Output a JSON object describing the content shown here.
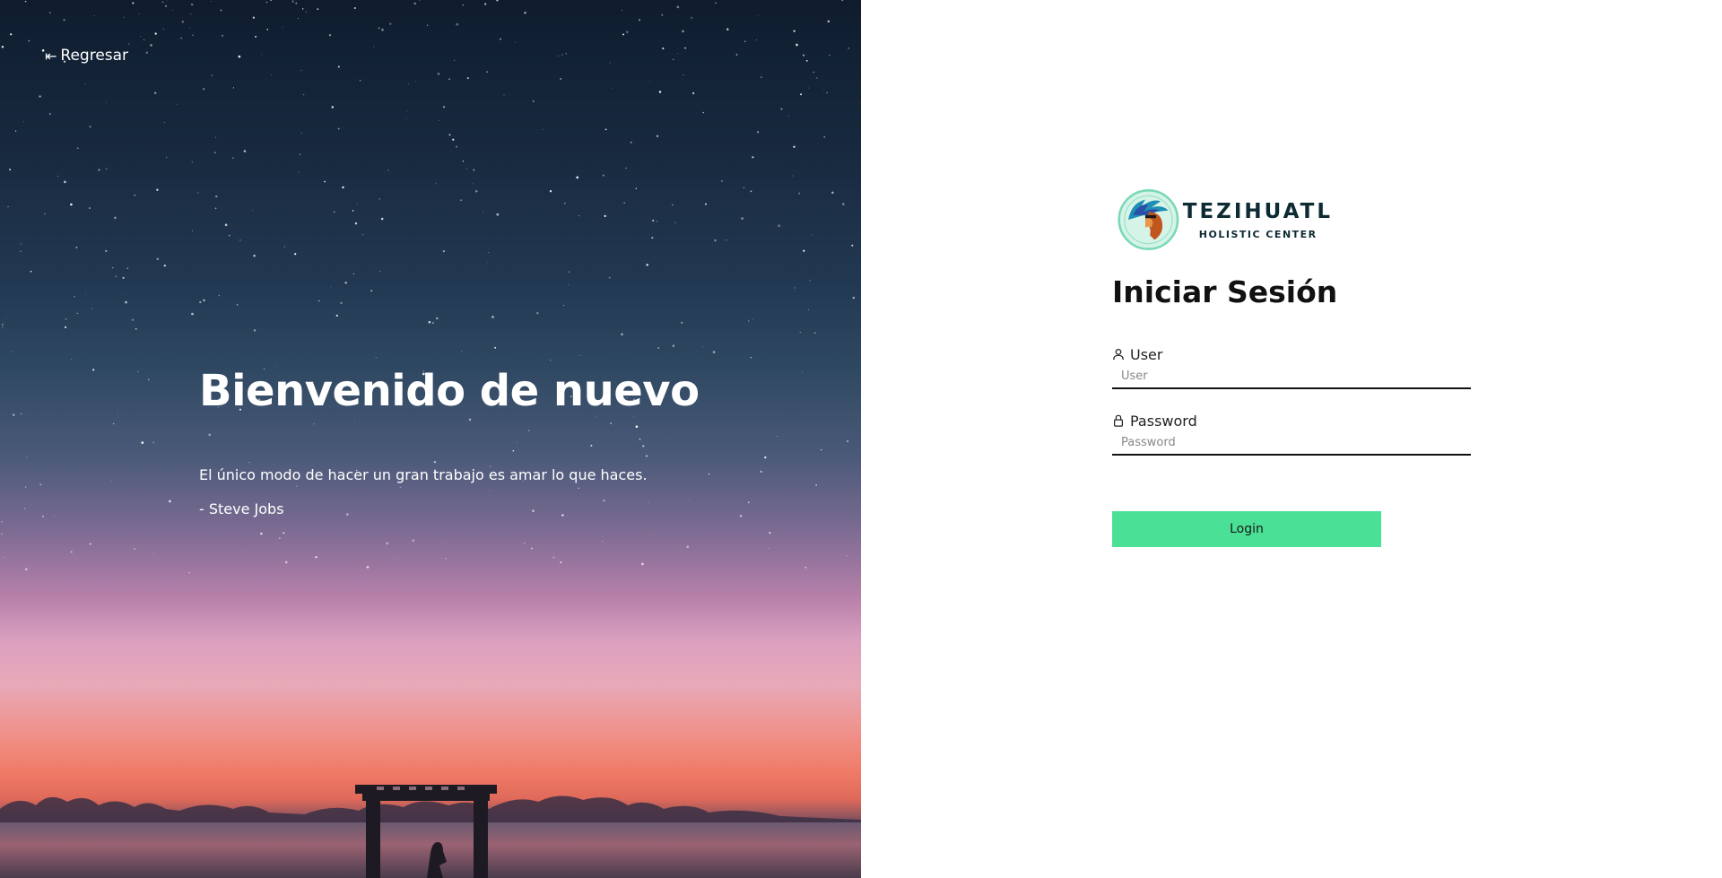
{
  "hero": {
    "back_label": "Regresar",
    "title": "Bienvenido de nuevo",
    "quote": "El único modo de hacer un gran trabajo es amar lo que haces.",
    "author": "- Steve Jobs"
  },
  "logo": {
    "name": "TEZIHUATL",
    "subtitle": "HOLISTIC CENTER"
  },
  "login": {
    "title": "Iniciar Sesión",
    "user_label": "User",
    "user_placeholder": "User",
    "user_value": "",
    "password_label": "Password",
    "password_placeholder": "Password",
    "password_value": "",
    "button_label": "Login"
  },
  "colors": {
    "accent": "#4ae095",
    "logo_text": "#0d2b33"
  },
  "icons": {
    "back": "arrow-left-to-bar-icon",
    "user": "user-icon",
    "password": "lock-icon"
  }
}
